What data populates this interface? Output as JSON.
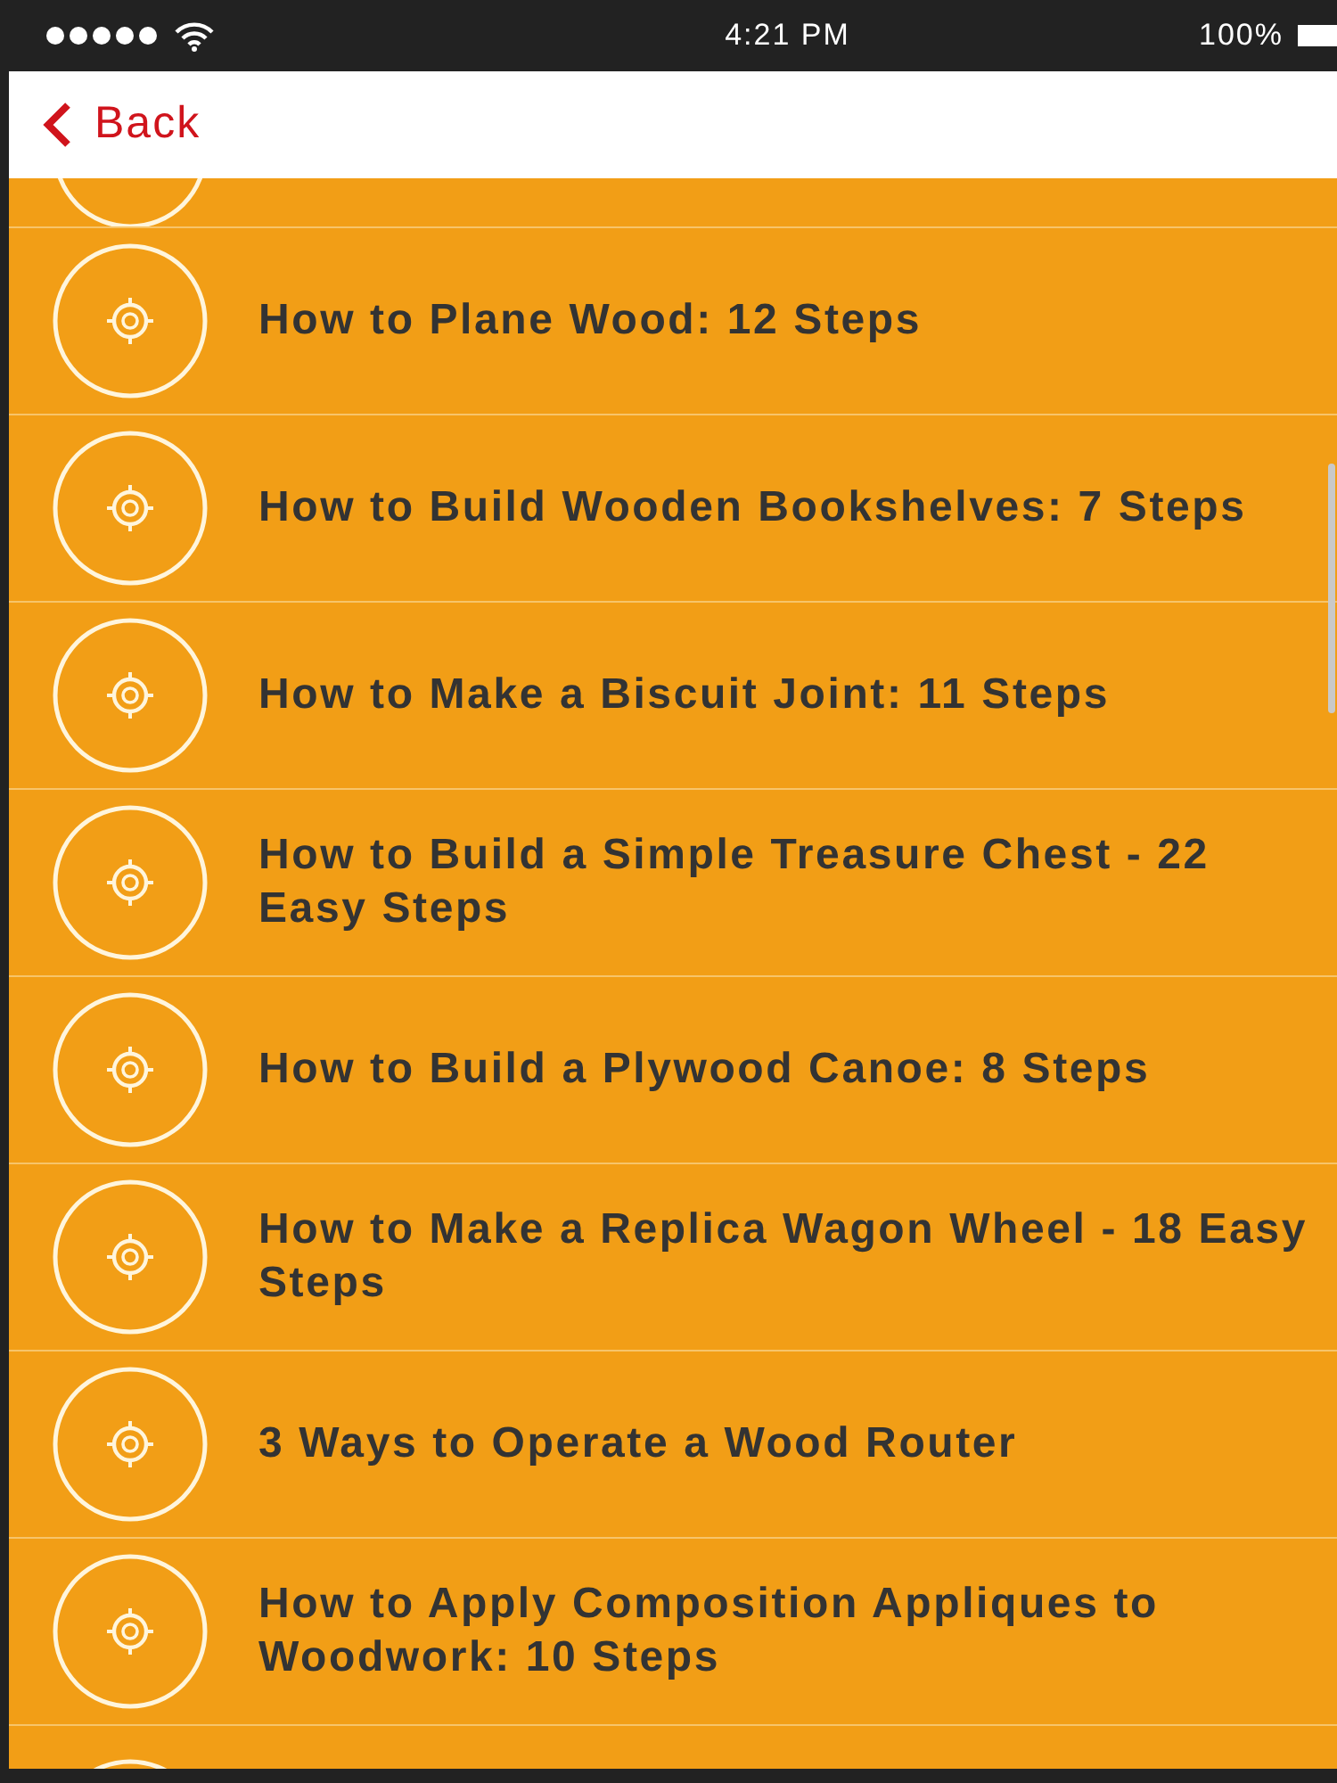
{
  "status_bar": {
    "time": "4:21 PM",
    "battery": "100%"
  },
  "nav": {
    "back_label": "Back"
  },
  "items": [
    {
      "title": "How to Plane Wood: 12 Steps"
    },
    {
      "title": "How to Build Wooden Bookshelves: 7 Steps"
    },
    {
      "title": "How to Make a Biscuit Joint: 11 Steps"
    },
    {
      "title": "How to Build a Simple Treasure Chest - 22 Easy Steps"
    },
    {
      "title": "How to Build a Plywood Canoe: 8 Steps"
    },
    {
      "title": "How to Make a Replica Wagon Wheel - 18 Easy Steps"
    },
    {
      "title": "3 Ways to Operate a Wood Router"
    },
    {
      "title": "How to Apply Composition Appliques to Woodwork: 10 Steps"
    }
  ]
}
